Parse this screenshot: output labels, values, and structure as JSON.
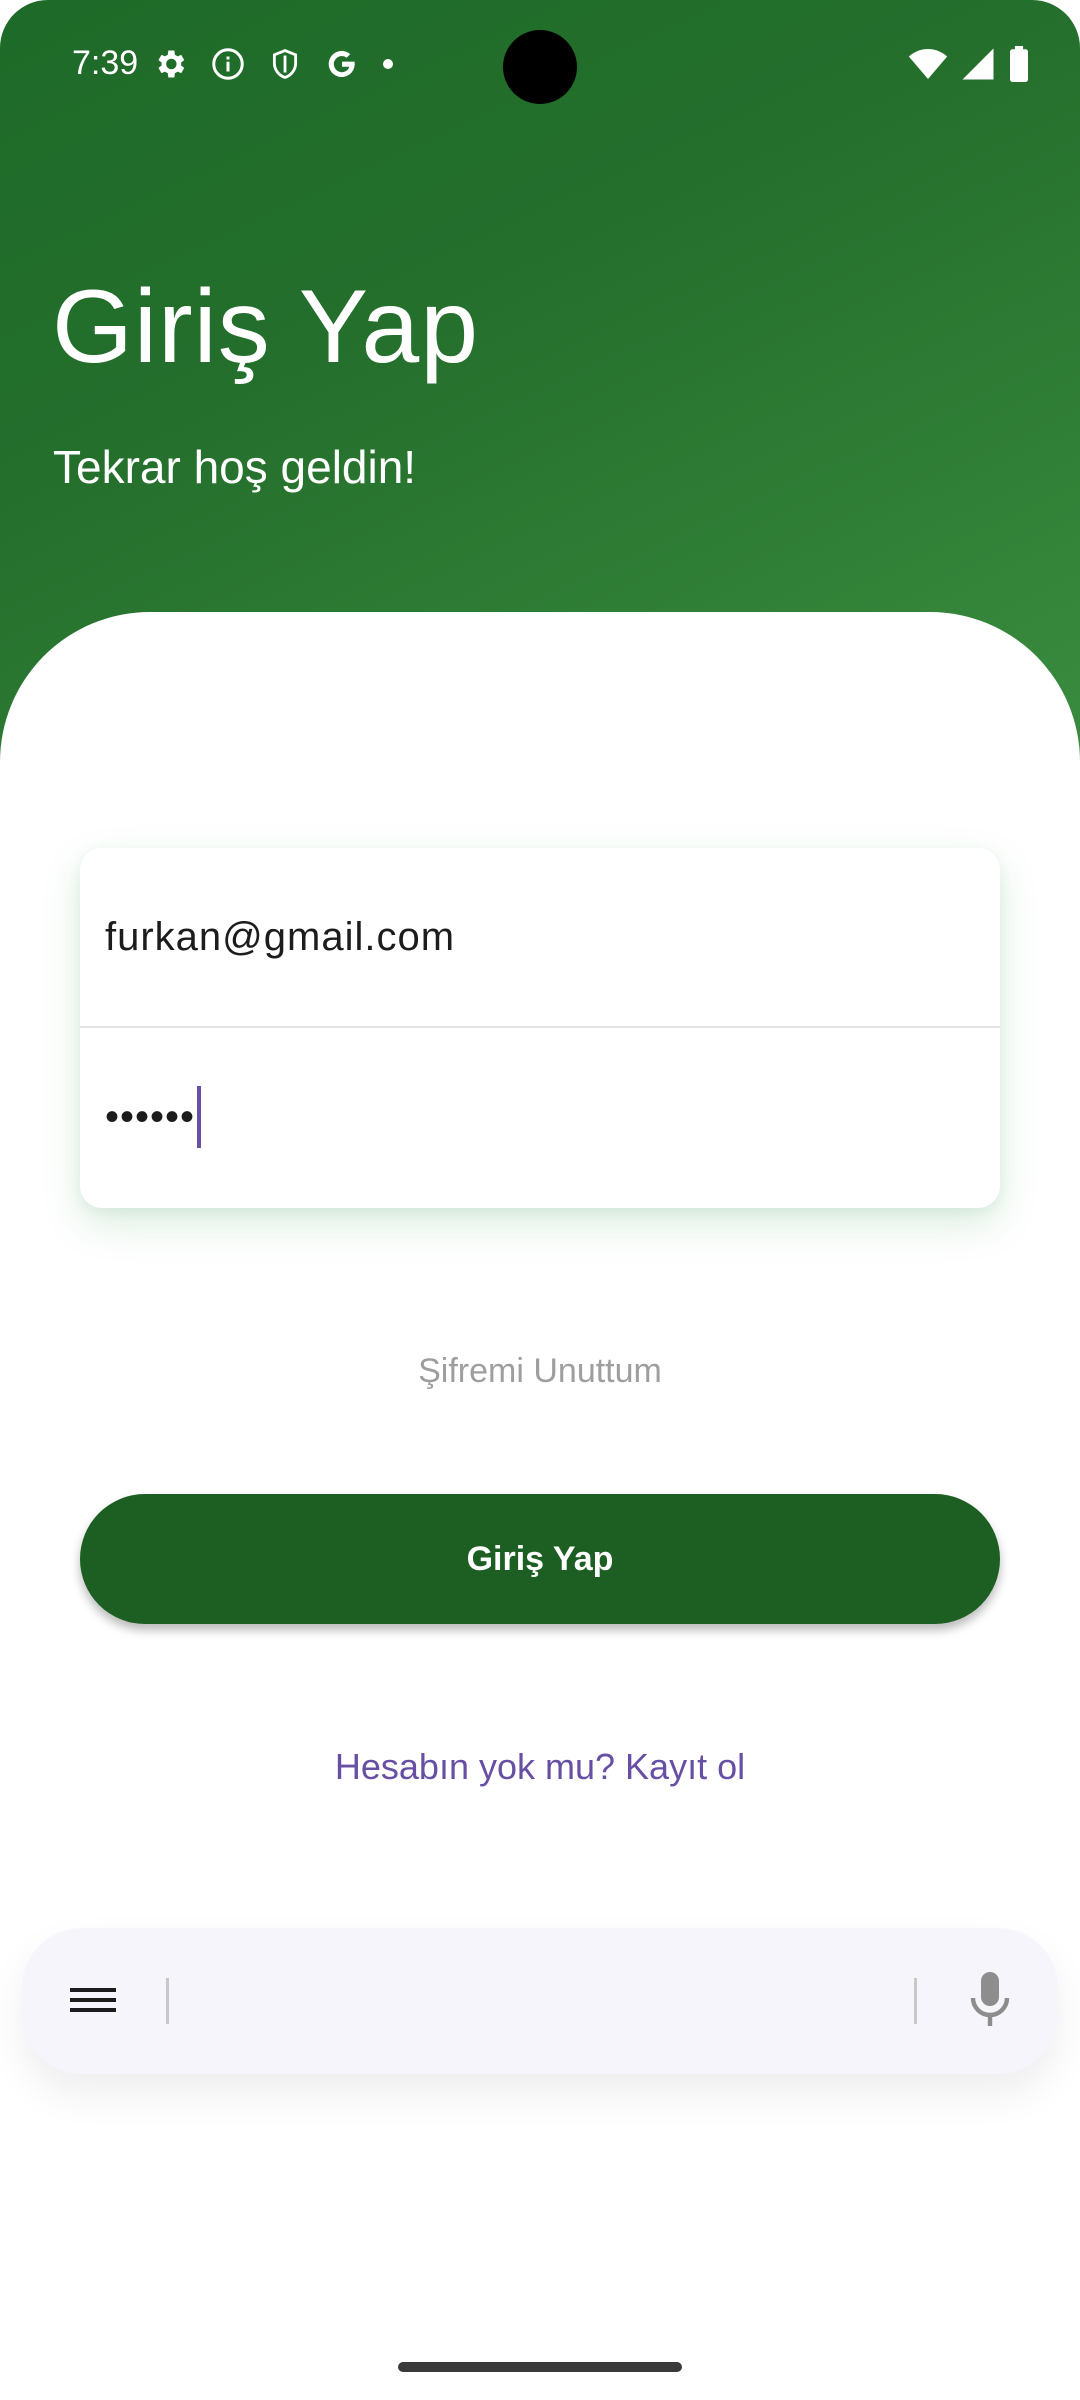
{
  "status_bar": {
    "time": "7:39",
    "left_icons": [
      "settings-icon",
      "info-icon",
      "shield-icon",
      "google-icon",
      "dot-icon"
    ],
    "right_icons": [
      "wifi-icon",
      "signal-icon",
      "battery-icon"
    ]
  },
  "header": {
    "title": "Giriş Yap",
    "subtitle": "Tekrar hoş geldin!",
    "gradient_start": "#1e6a28",
    "gradient_end": "#3a8c3f"
  },
  "form": {
    "email_value": "furkan@gmail.com",
    "password_masked": "••••••"
  },
  "links": {
    "forgot_password": "Şifremi Unuttum",
    "register": "Hesabın yok mu? Kayıt ol"
  },
  "buttons": {
    "login_label": "Giriş Yap",
    "login_color": "#1d5e22"
  },
  "keyboard_bar": {
    "left_icon": "menu-icon",
    "right_icon": "microphone-icon"
  },
  "accent_color": "#6750a4"
}
